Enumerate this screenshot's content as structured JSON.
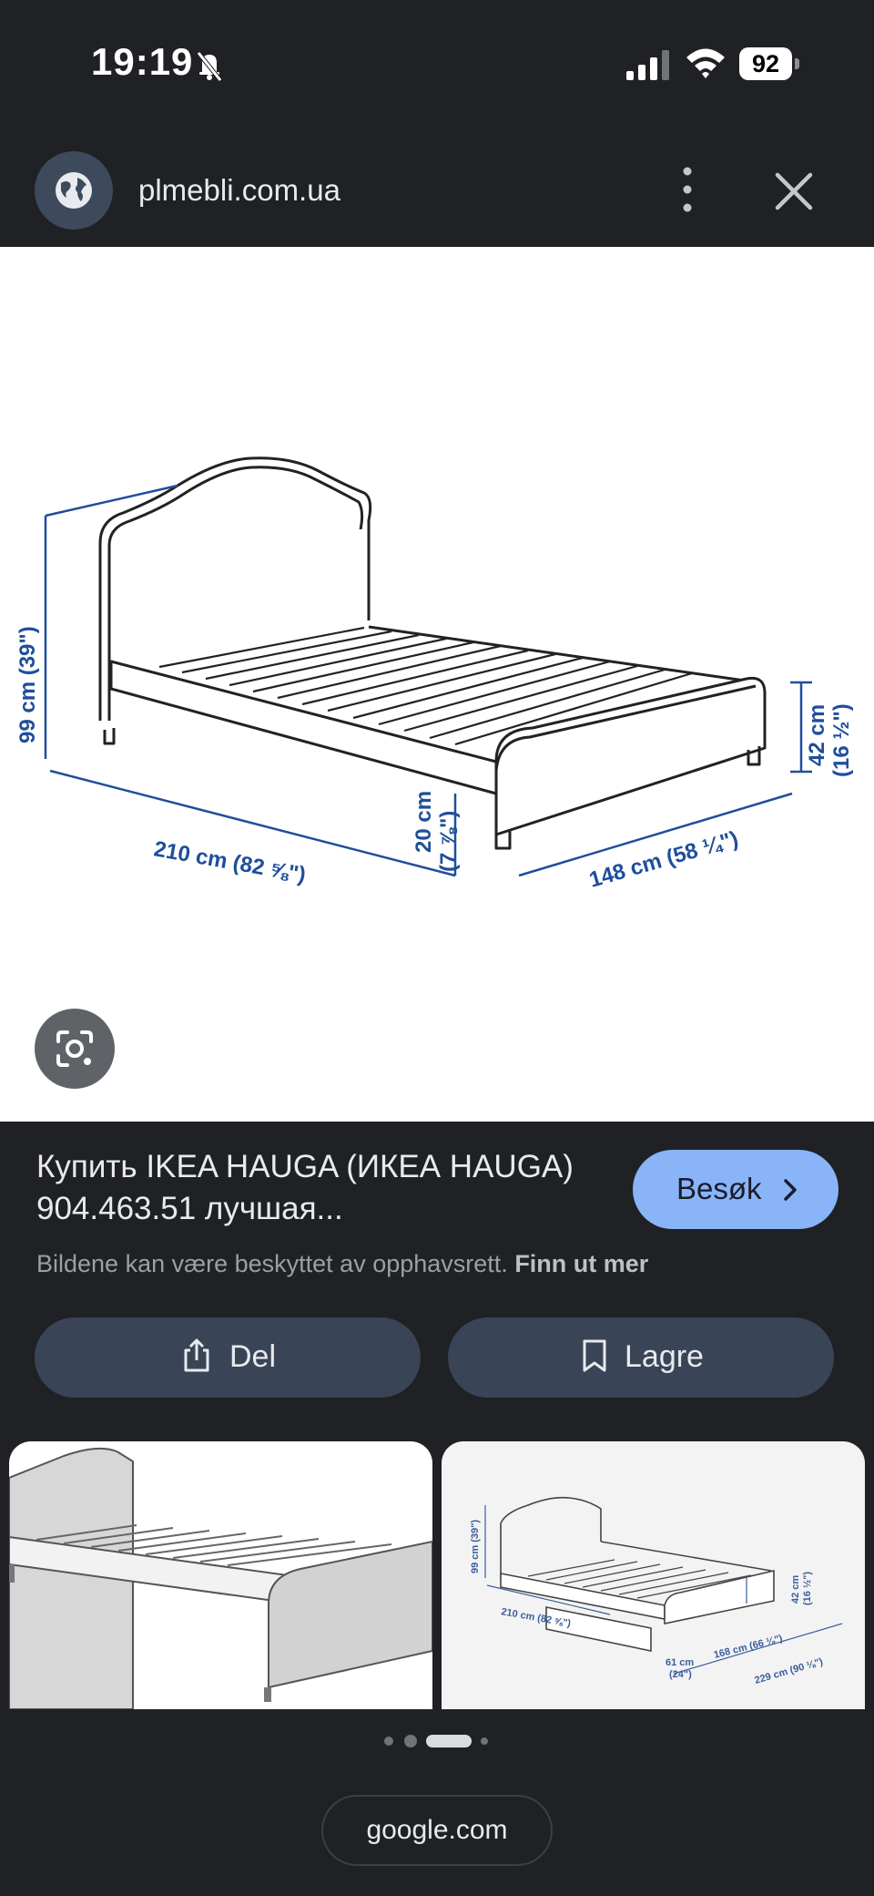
{
  "status_bar": {
    "time": "19:19",
    "battery": "92"
  },
  "browser": {
    "domain": "plmebli.com.ua"
  },
  "diagram": {
    "dim_height": "99 cm (39\")",
    "dim_length": "210 cm (82 ⅝\")",
    "dim_clearance": "20 cm",
    "dim_clearance_in": "(7 ⅞\")",
    "dim_width": "148 cm (58 ¼\")",
    "dim_foot": "42 cm",
    "dim_foot_in": "(16 ½\")"
  },
  "result": {
    "title": "Купить IKEA HAUGA (ИКЕА HAUGA) 904.463.51 лучшая...",
    "visit_label": "Besøk",
    "copyright": "Bildene kan være beskyttet av opphavsrett.",
    "learn_more": "Finn ut mer"
  },
  "actions": {
    "share_label": "Del",
    "save_label": "Lagre"
  },
  "thumb_right": {
    "dim_height": "99 cm (39\")",
    "dim_length": "210 cm (82 ⅝\")",
    "dim_drawer": "61 cm",
    "dim_drawer_in": "(24\")",
    "dim_width": "168 cm (66 ⅛\")",
    "dim_total": "229 cm (90 ⅛\")",
    "dim_foot": "42 cm",
    "dim_foot_in": "(16 ½\")"
  },
  "pagination": {
    "total": 4,
    "active": 2
  },
  "source": {
    "label": "google.com"
  },
  "colors": {
    "background": "#202124",
    "accent": "#8ab4f8",
    "button": "#394457",
    "dimension": "#1f4e9b"
  }
}
